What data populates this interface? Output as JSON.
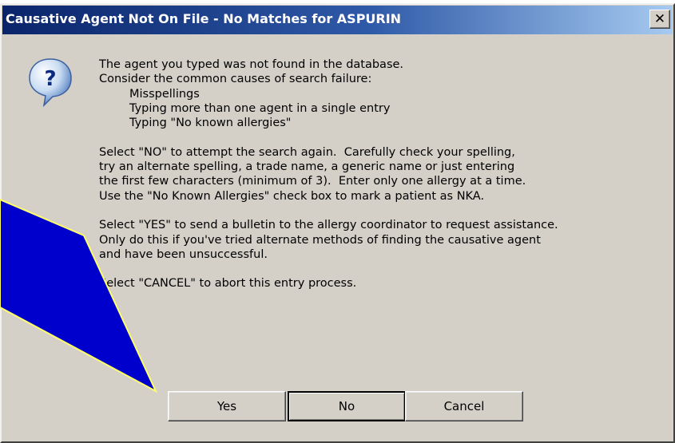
{
  "dialog": {
    "title": "Causative Agent Not On File - No Matches for ASPURIN",
    "close_label": "✕",
    "icon": "question-icon",
    "message": {
      "line1": "The agent you typed was not found in the database.",
      "line2": "Consider the common causes of search failure:",
      "causes": [
        "Misspellings",
        "Typing more than one agent in a single entry",
        "Typing \"No known allergies\""
      ],
      "no_paragraph": [
        "Select \"NO\" to attempt the search again.  Carefully check your spelling,",
        "try an alternate spelling, a trade name, a generic name or just entering",
        "the first few characters (minimum of 3).  Enter only one allergy at a time.",
        "Use the \"No Known Allergies\" check box to mark a patient as NKA."
      ],
      "yes_paragraph": [
        "Select \"YES\" to send a bulletin to the allergy coordinator to request assistance.",
        "Only do this if you've tried alternate methods of finding the causative agent",
        "and have been unsuccessful."
      ],
      "cancel_line": "Select \"CANCEL\" to abort this entry process."
    },
    "buttons": {
      "yes": "Yes",
      "no": "No",
      "cancel": "Cancel"
    }
  },
  "colors": {
    "title_start": "#0a246a",
    "title_end": "#a6caf0",
    "dialog_bg": "#d4d0c8",
    "callout_fill": "#0000cc",
    "callout_stroke": "#ffff66"
  }
}
